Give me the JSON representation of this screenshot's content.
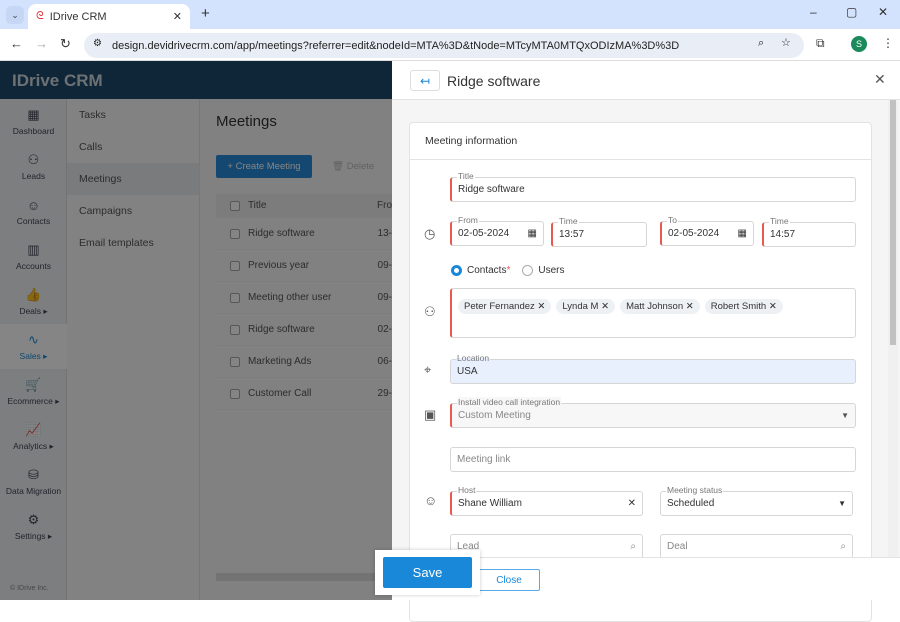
{
  "browser": {
    "tab_title": "IDrive CRM",
    "url": "design.devidrivecrm.com/app/meetings?referrer=edit&nodeId=MTA%3D&tNode=MTcyMTA0MTQxODIzMA%3D%3D",
    "profile_initial": "S"
  },
  "app": {
    "logo": "IDrive CRM",
    "copyright": "© IDrive Inc."
  },
  "nav": [
    {
      "label": "Dashboard",
      "icon": "▦"
    },
    {
      "label": "Leads",
      "icon": "⚇"
    },
    {
      "label": "Contacts",
      "icon": "☺"
    },
    {
      "label": "Accounts",
      "icon": "▥"
    },
    {
      "label": "Deals ▸",
      "icon": "👍"
    },
    {
      "label": "Sales ▸",
      "icon": "∿"
    },
    {
      "label": "Ecommerce ▸",
      "icon": "🛒"
    },
    {
      "label": "Analytics ▸",
      "icon": "📈"
    },
    {
      "label": "Data Migration",
      "icon": "⛁"
    },
    {
      "label": "Settings ▸",
      "icon": "⚙"
    }
  ],
  "submenu": [
    "Tasks",
    "Calls",
    "Meetings",
    "Campaigns",
    "Email templates"
  ],
  "main": {
    "title": "Meetings",
    "create_label": "+ Create Meeting",
    "delete_label": "Delete",
    "col_title": "Title",
    "col_from": "Fro",
    "rows": [
      {
        "title": "Ridge software",
        "from": "13-"
      },
      {
        "title": "Previous year",
        "from": "09-"
      },
      {
        "title": "Meeting other user",
        "from": "09-"
      },
      {
        "title": "Ridge software",
        "from": "02-"
      },
      {
        "title": "Marketing Ads",
        "from": "06-"
      },
      {
        "title": "Customer Call",
        "from": "29-"
      }
    ]
  },
  "panel": {
    "title": "Ridge software",
    "section": "Meeting information",
    "title_label": "Title",
    "title_value": "Ridge software",
    "from_label": "From",
    "from_date": "02-05-2024",
    "time_label": "Time",
    "from_time": "13:57",
    "to_label": "To",
    "to_date": "02-05-2024",
    "to_time": "14:57",
    "contacts_label": "Contacts",
    "required_mark": "*",
    "users_label": "Users",
    "participants": [
      "Peter Fernandez",
      "Lynda M",
      "Matt Johnson",
      "Robert Smith"
    ],
    "location_label": "Location",
    "location_value": "USA",
    "video_label": "Install video call integration",
    "video_value": "Custom Meeting",
    "link_placeholder": "Meeting link",
    "host_label": "Host",
    "host_value": "Shane William",
    "status_label": "Meeting status",
    "status_value": "Scheduled",
    "lead_placeholder": "Lead",
    "deal_placeholder": "Deal",
    "save_label": "Save",
    "close_label": "Close"
  },
  "colors": {
    "accent": "#1a88d8",
    "header": "#1d4a6b",
    "required": "#e8594f"
  }
}
